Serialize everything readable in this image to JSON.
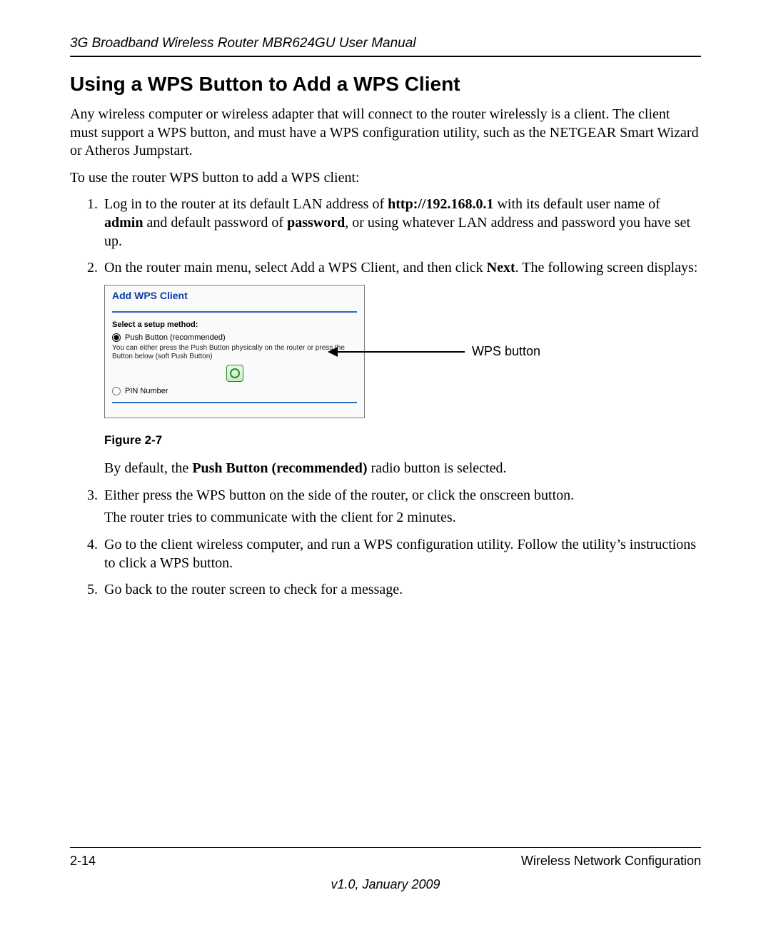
{
  "header": {
    "running_title": "3G Broadband Wireless Router MBR624GU User Manual"
  },
  "section": {
    "title": "Using a WPS Button to Add a WPS Client",
    "intro": "Any wireless computer or wireless adapter that will connect to the router wirelessly is a client. The client must support a WPS button, and must have a WPS configuration utility, such as the NETGEAR Smart Wizard or Atheros Jumpstart.",
    "lead_in": "To use the router WPS button to add a WPS client:"
  },
  "steps": {
    "s1": {
      "pre": "Log in to the router at its default LAN address of ",
      "url": "http://192.168.0.1",
      "mid1": " with its default user name of ",
      "admin": "admin",
      "mid2": " and default password of ",
      "password": "password",
      "post": ", or using whatever LAN address and password you have set up."
    },
    "s2": {
      "pre": "On the router main menu, select Add a WPS Client, and then click ",
      "next": "Next",
      "post": ". The following screen displays:"
    },
    "s2_fig": {
      "panel_title": "Add WPS Client",
      "setup_label": "Select a setup method:",
      "radio_push": "Push Button (recommended)",
      "help": "You can either press the Push Button physically on the router or press the Button below (soft Push Button)",
      "radio_pin": "PIN Number",
      "callout": "WPS button",
      "caption": "Figure 2-7"
    },
    "s2_after": {
      "pre": "By default, the ",
      "bold": "Push Button (recommended)",
      "post": " radio button is selected."
    },
    "s3": {
      "line1": "Either press the WPS button on the side of the router, or click the onscreen button.",
      "line2": "The router tries to communicate with the client for 2 minutes."
    },
    "s4": "Go to the client wireless computer, and run a WPS configuration utility. Follow the utility’s instructions to click a WPS button.",
    "s5": "Go back to the router screen to check for a message."
  },
  "footer": {
    "page_num": "2-14",
    "section_name": "Wireless Network Configuration",
    "version": "v1.0, January 2009"
  }
}
